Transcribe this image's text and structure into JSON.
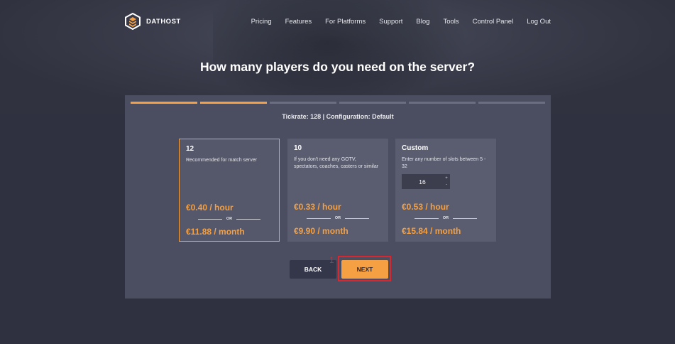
{
  "brand": {
    "name": "DATHOST"
  },
  "nav": {
    "items": [
      {
        "label": "Pricing"
      },
      {
        "label": "Features"
      },
      {
        "label": "For Platforms"
      },
      {
        "label": "Support"
      },
      {
        "label": "Blog"
      },
      {
        "label": "Tools"
      },
      {
        "label": "Control Panel"
      },
      {
        "label": "Log Out"
      }
    ]
  },
  "page": {
    "question": "How many players do you need on the server?"
  },
  "progress": {
    "total_steps": 6,
    "completed_steps": 2
  },
  "config": {
    "text": "Tickrate: 128 | Configuration: Default"
  },
  "plans": [
    {
      "title": "12",
      "description": "Recommended for match server",
      "price_hour": "€0.40 / hour",
      "or": "OR",
      "price_month": "€11.88 / month",
      "selected": true
    },
    {
      "title": "10",
      "description": "If you don't need any GOTV, spectators, coaches, casters or similar",
      "price_hour": "€0.33 / hour",
      "or": "OR",
      "price_month": "€9.90 / month",
      "selected": false
    },
    {
      "title": "Custom",
      "description": "Enter any number of slots between 5 - 32",
      "slots_value": "16",
      "price_hour": "€0.53 / hour",
      "or": "OR",
      "price_month": "€15.84 / month",
      "selected": false
    }
  ],
  "buttons": {
    "back": "BACK",
    "next": "NEXT"
  },
  "annotation": {
    "label": "1"
  },
  "colors": {
    "accent": "#f5a042",
    "panel": "#4b4d60",
    "highlight": "#d9262f"
  }
}
